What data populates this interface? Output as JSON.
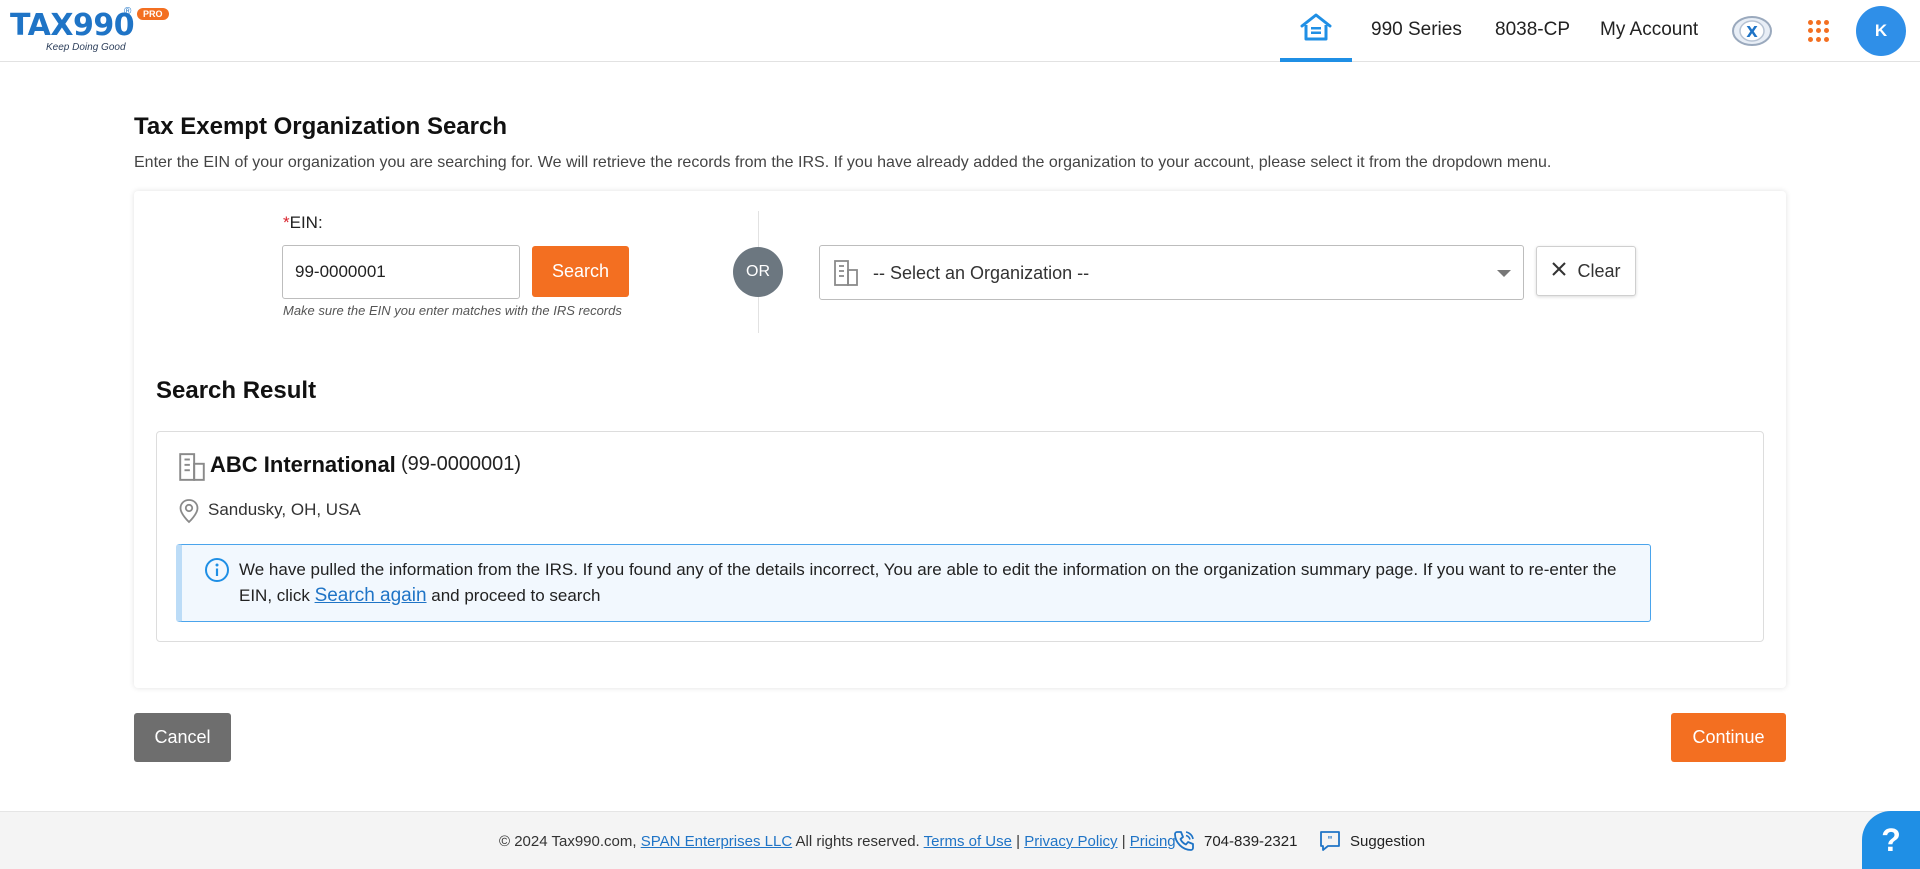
{
  "brand": {
    "logo_text": "TAX990",
    "registered": "®",
    "badge": "PRO",
    "tagline": "Keep Doing Good"
  },
  "nav": {
    "items": [
      "990 Series",
      "8038-CP",
      "My Account"
    ],
    "avatar_initial": "K",
    "accent_color": "#1f8fe5"
  },
  "page": {
    "title": "Tax Exempt Organization Search",
    "description": "Enter the EIN of your organization you are searching for. We will retrieve the records from the IRS. If you have already added the organization to your account, please select it from the dropdown menu."
  },
  "search": {
    "required_mark": "*",
    "ein_label": "EIN:",
    "ein_value": "99-0000001",
    "search_label": "Search",
    "hint": "Make sure the EIN you enter matches with the IRS records",
    "or_label": "OR",
    "org_select_placeholder": "-- Select an Organization --",
    "clear_label": "Clear"
  },
  "result": {
    "heading": "Search Result",
    "org_name": "ABC International",
    "org_ein": "(99-0000001)",
    "location": "Sandusky, OH, USA",
    "info_text_before": "We have pulled the information from the IRS. If you found any of the details incorrect, You are able to edit the information on the organization summary page. If you want to re-enter the EIN, click ",
    "info_link": "Search again",
    "info_text_after": " and proceed to search"
  },
  "actions": {
    "cancel_label": "Cancel",
    "continue_label": "Continue"
  },
  "footer": {
    "copyright": "© 2024 Tax990.com, ",
    "company_link": "SPAN Enterprises LLC",
    "rights": " All rights reserved. ",
    "terms": "Terms of Use",
    "separator": " | ",
    "privacy": "Privacy Policy",
    "pricing": "Pricing",
    "phone": "704-839-2321",
    "suggestion": "Suggestion",
    "help": "?"
  },
  "colors": {
    "primary_orange": "#f36f21",
    "primary_blue": "#1f74c6",
    "cancel_gray": "#6e6e6e"
  }
}
